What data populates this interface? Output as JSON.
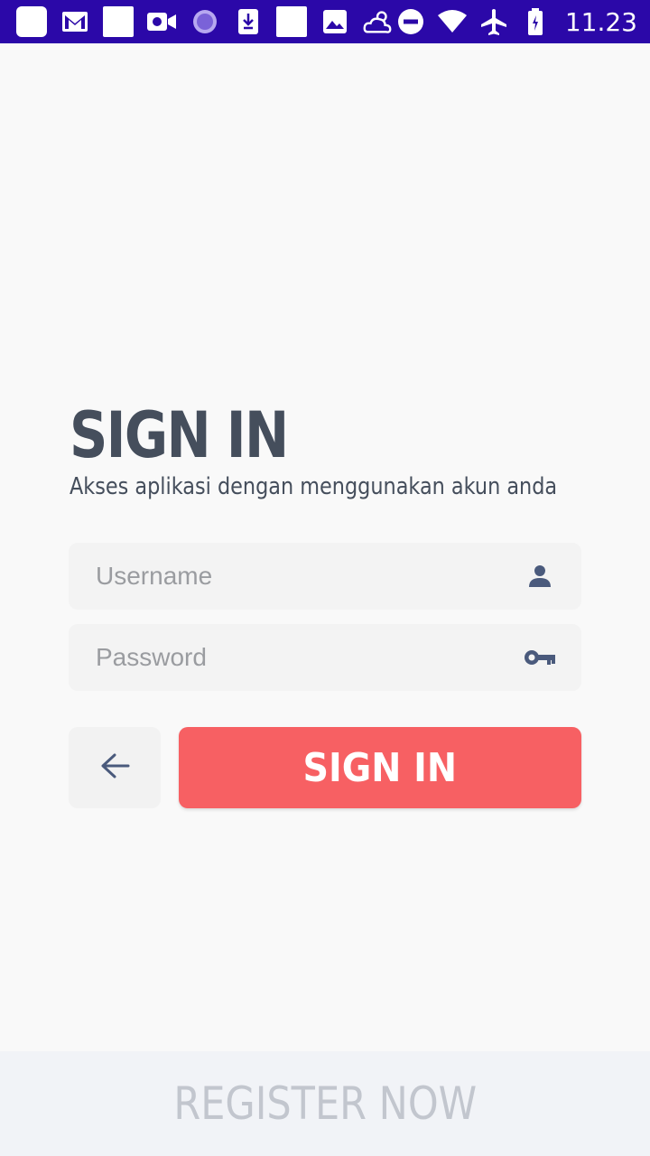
{
  "status_bar": {
    "time": "11.23",
    "left_icons": [
      "app-icon",
      "gmail-icon",
      "blank-icon",
      "video-camera-icon",
      "loading-icon",
      "download-icon",
      "blank-icon",
      "image-icon",
      "cloud-sun-icon"
    ],
    "right_icons": [
      "do-not-disturb-icon",
      "wifi-icon",
      "airplane-mode-icon",
      "battery-icon"
    ]
  },
  "header": {
    "title": "SIGN IN",
    "subtitle": "Akses aplikasi dengan menggunakan akun anda"
  },
  "form": {
    "username_placeholder": "Username",
    "username_value": "",
    "password_placeholder": "Password",
    "password_value": ""
  },
  "actions": {
    "signin_label": "SIGN IN"
  },
  "footer": {
    "register_label": "REGISTER NOW"
  },
  "colors": {
    "status_bar": "#2b08a8",
    "primary_button": "#f76063",
    "text_dark": "#454e5c",
    "icon": "#4a5a7c"
  }
}
